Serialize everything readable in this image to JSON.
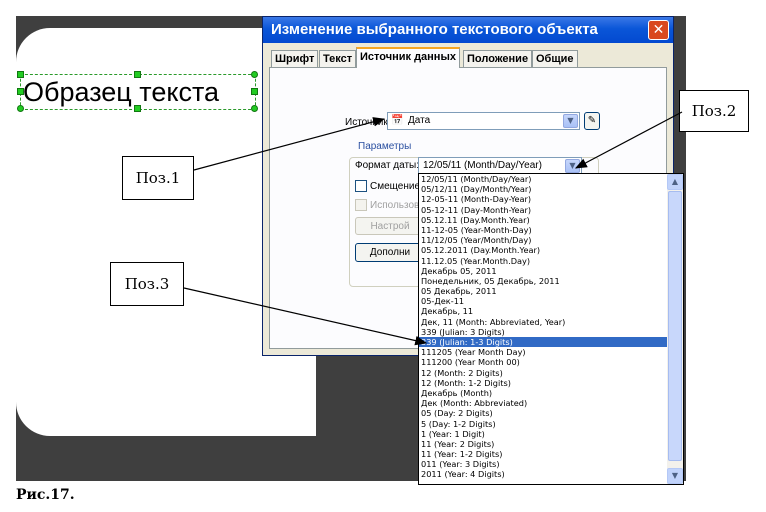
{
  "sample_text": "Образец текста",
  "dialog": {
    "title": "Изменение выбранного текстового объекта",
    "close_glyph": "✕",
    "tabs": [
      "Шрифт",
      "Текст",
      "Источник данных",
      "Положение",
      "Общие"
    ],
    "source_label": "Источник:",
    "source_value": "Дата",
    "params_group": "Параметры",
    "date_format_label": "Формат даты:",
    "date_format_value": "12/05/11 (Month/Day/Year)",
    "offset_label": "Смещение:",
    "use_label": "Использоват",
    "settings_button": "Настрой",
    "more_button": "Дополни"
  },
  "dropdown": {
    "selected_index": 17,
    "items": [
      "12/05/11 (Month/Day/Year)",
      "05/12/11 (Day/Month/Year)",
      "12-05-11 (Month-Day-Year)",
      "05-12-11 (Day-Month-Year)",
      "05.12.11 (Day.Month.Year)",
      "11-12-05 (Year-Month-Day)",
      "11/12/05 (Year/Month/Day)",
      "05.12.2011 (Day.Month.Year)",
      "11.12.05 (Year.Month.Day)",
      "Декабрь 05, 2011",
      "Понедельник, 05 Декабрь, 2011",
      "05 Декабрь, 2011",
      "05-Дек-11",
      "Декабрь, 11",
      "Дек, 11 (Month: Abbreviated, Year)",
      "339 (Julian: 3 Digits)",
      "339 (Julian: 1-3 Digits)",
      "111205 (Year Month Day)",
      "111200 (Year Month 00)",
      "12 (Month: 2 Digits)",
      "12 (Month: 1-2 Digits)",
      "Декабрь (Month)",
      "Дек (Month: Abbreviated)",
      "05 (Day: 2 Digits)",
      "5 (Day: 1-2 Digits)",
      "1 (Year: 1 Digit)",
      "11 (Year: 2 Digits)",
      "11 (Year: 1-2 Digits)",
      "011 (Year: 3 Digits)",
      "2011 (Year: 4 Digits)"
    ]
  },
  "callouts": {
    "pos1": "Поз.1",
    "pos2": "Поз.2",
    "pos3": "Поз.3"
  },
  "caption": "Рис.17.",
  "colors": {
    "titlebar": "#0a56d8",
    "selection": "#316ac5",
    "handles": "#22cc22"
  }
}
